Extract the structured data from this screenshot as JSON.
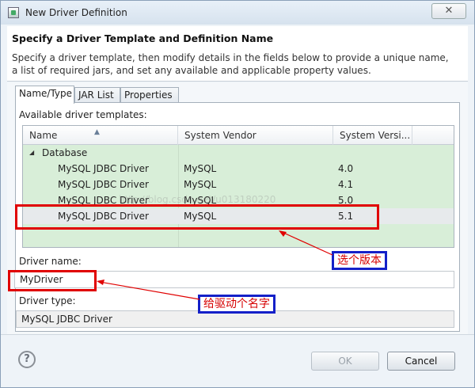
{
  "window": {
    "title": "New Driver Definition",
    "close_glyph": "✕"
  },
  "header": {
    "title": "Specify a Driver Template and Definition Name",
    "description": "Specify a driver template, then modify details in the fields below to provide a unique name, a list of required jars, and set any available and applicable property values."
  },
  "tabs": [
    {
      "label": "Name/Type",
      "active": true
    },
    {
      "label": "JAR List",
      "active": false
    },
    {
      "label": "Properties",
      "active": false
    }
  ],
  "templates": {
    "label": "Available driver templates:",
    "columns": [
      "Name",
      "System Vendor",
      "System Versi..."
    ],
    "group": {
      "arrow": "◢",
      "name": "Database"
    },
    "rows": [
      {
        "name": "MySQL JDBC Driver",
        "vendor": "MySQL",
        "version": "4.0"
      },
      {
        "name": "MySQL JDBC Driver",
        "vendor": "MySQL",
        "version": "4.1"
      },
      {
        "name": "MySQL JDBC Driver",
        "vendor": "MySQL",
        "version": "5.0"
      },
      {
        "name": "MySQL JDBC Driver",
        "vendor": "MySQL",
        "version": "5.1"
      }
    ],
    "selected_index": 3
  },
  "driver_name": {
    "label": "Driver name:",
    "value": "MyDriver"
  },
  "driver_type": {
    "label": "Driver type:",
    "value": "MySQL JDBC Driver"
  },
  "buttons": {
    "help": "?",
    "ok": "OK",
    "cancel": "Cancel"
  },
  "annotations": {
    "version_note": "选个版本",
    "name_note": "给驱动个名字",
    "box_color": "#e00000",
    "label_border_color": "#1420c8",
    "label_text_color": "#d60000"
  },
  "watermark": "http://blog.csdn.net/u013180220"
}
